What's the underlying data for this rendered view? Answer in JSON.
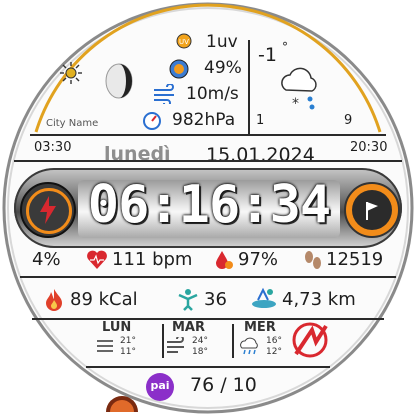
{
  "weather_panel": {
    "uv": "1uv",
    "humidity": "49%",
    "wind": "10m/s",
    "pressure": "982hPa",
    "city": "City Name",
    "temp_now": "-1",
    "temp_min": "1",
    "temp_max": "9",
    "sunrise": "03:30",
    "sunset": "20:30"
  },
  "date": {
    "weekday": "lunedì",
    "date": "15.01.2024"
  },
  "time": {
    "value": "06:16:34"
  },
  "stats_row1": {
    "battery": "4%",
    "heart_rate": "111 bpm",
    "spo2": "97%",
    "steps": "12519"
  },
  "stats_row2": {
    "calories": "89 kCal",
    "stand": "36",
    "distance": "4,73 km"
  },
  "forecast": [
    {
      "day": "LUN",
      "high": "21°",
      "low": "11°",
      "icon": "fog-icon"
    },
    {
      "day": "MAR",
      "high": "24°",
      "low": "18°",
      "icon": "wind-icon"
    },
    {
      "day": "MER",
      "high": "16°",
      "low": "12°",
      "icon": "rain-cloud-icon"
    }
  ],
  "pai": {
    "badge": "pai",
    "value": "76 / 10"
  },
  "colors": {
    "accent_orange": "#f28c1a",
    "alert_red": "#d9282f",
    "sun_arc": "#d9a21a",
    "pai_purple": "#8b2fc9"
  }
}
